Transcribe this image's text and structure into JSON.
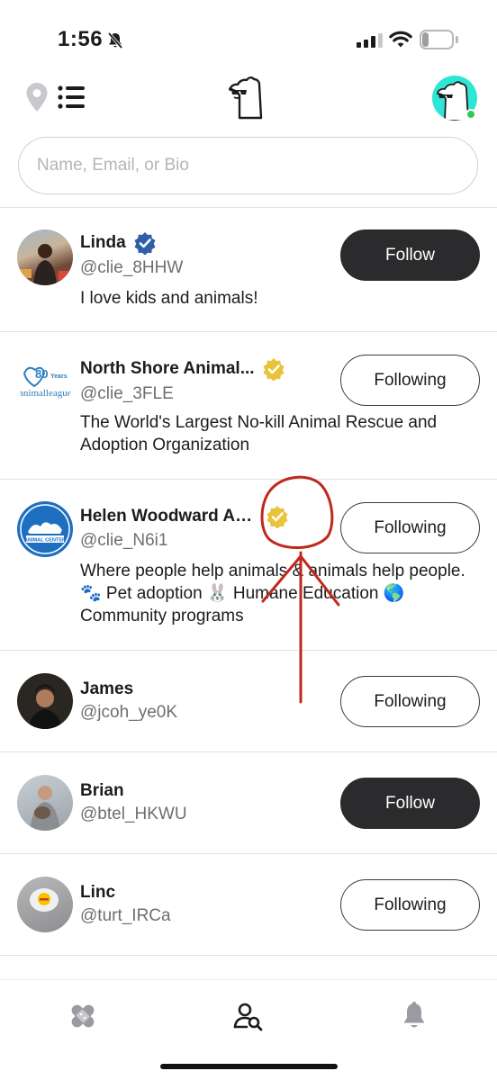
{
  "status_bar": {
    "time": "1:56",
    "battery": "22"
  },
  "search": {
    "placeholder": "Name, Email, or Bio",
    "value": ""
  },
  "users": [
    {
      "name": "Linda",
      "handle": "@clie_8HHW",
      "bio": "I love kids and animals!",
      "button": "Follow",
      "verified": "blue"
    },
    {
      "name": "North Shore Animal...",
      "handle": "@clie_3FLE",
      "bio": "The World's Largest No-kill Animal Rescue and Adoption Organization",
      "button": "Following",
      "verified": "gold",
      "avatar_text": "80",
      "avatar_text2": "Years",
      "avatar_text3": "animalleague"
    },
    {
      "name": "Helen Woodward Ani...",
      "handle": "@clie_N6i1",
      "bio": "Where people help animals & animals help people. 🐾 Pet adoption 🐰 Humane Education 🌎 Community programs",
      "button": "Following",
      "verified": "gold",
      "avatar_text": "ANIMAL CENTER"
    },
    {
      "name": "James",
      "handle": "@jcoh_ye0K",
      "bio": "",
      "button": "Following"
    },
    {
      "name": "Brian",
      "handle": "@btel_HKWU",
      "bio": "",
      "button": "Follow"
    },
    {
      "name": "Linc",
      "handle": "@turt_IRCa",
      "bio": "",
      "button": "Following"
    }
  ],
  "colors": {
    "verified_blue": "#2f5fa8",
    "verified_gold": "#e9c33a",
    "annotation_red": "#c0281c",
    "me_avatar_bg": "#2ee6d6"
  },
  "icons": [
    "bell-slash-icon",
    "signal-icon",
    "wifi-icon",
    "battery-icon",
    "location-pin-icon",
    "list-icon",
    "bear-logo-icon",
    "bandage-icon",
    "search-people-icon",
    "bell-icon"
  ]
}
